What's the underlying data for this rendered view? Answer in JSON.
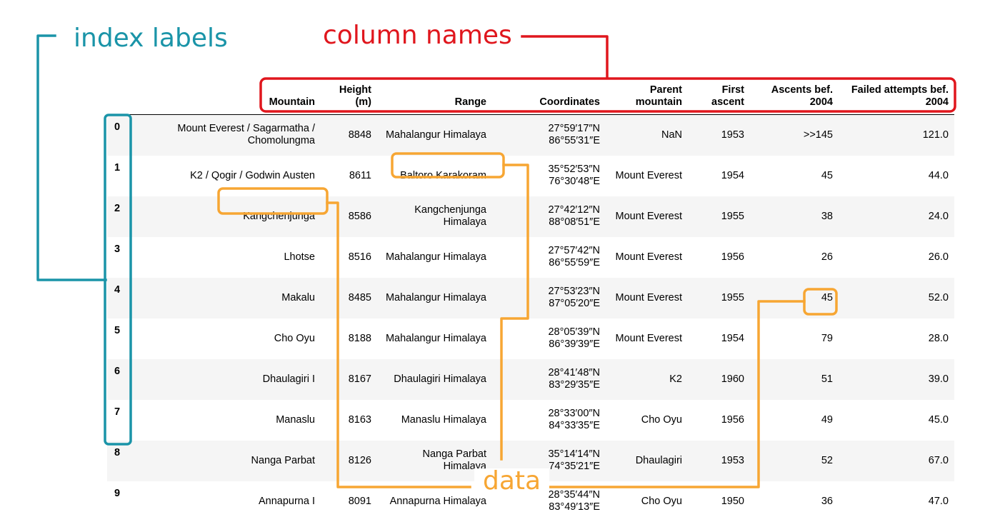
{
  "annotations": {
    "index_labels": "index labels",
    "column_names": "column names",
    "data": "data"
  },
  "colors": {
    "index": "#1a94a8",
    "columns": "#e0161d",
    "data": "#f7a633"
  },
  "table": {
    "columns": [
      {
        "key": "mountain",
        "label": "Mountain"
      },
      {
        "key": "height",
        "label": "Height (m)"
      },
      {
        "key": "range",
        "label": "Range"
      },
      {
        "key": "coordinates",
        "label": "Coordinates"
      },
      {
        "key": "parent",
        "label": "Parent mountain"
      },
      {
        "key": "first_ascent",
        "label": "First ascent"
      },
      {
        "key": "ascents",
        "label": "Ascents bef. 2004"
      },
      {
        "key": "failed",
        "label": "Failed attempts bef. 2004"
      }
    ],
    "rows": [
      {
        "index": "0",
        "mountain": "Mount Everest / Sagarmatha / Chomolungma",
        "height": "8848",
        "range": "Mahalangur Himalaya",
        "coordinates": "27°59′17″N 86°55′31″E",
        "parent": "NaN",
        "first_ascent": "1953",
        "ascents": ">>145",
        "failed": "121.0"
      },
      {
        "index": "1",
        "mountain": "K2 / Qogir / Godwin Austen",
        "height": "8611",
        "range": "Baltoro Karakoram",
        "coordinates": "35°52′53″N 76°30′48″E",
        "parent": "Mount Everest",
        "first_ascent": "1954",
        "ascents": "45",
        "failed": "44.0"
      },
      {
        "index": "2",
        "mountain": "Kangchenjunga",
        "height": "8586",
        "range": "Kangchenjunga Himalaya",
        "coordinates": "27°42′12″N 88°08′51″E",
        "parent": "Mount Everest",
        "first_ascent": "1955",
        "ascents": "38",
        "failed": "24.0"
      },
      {
        "index": "3",
        "mountain": "Lhotse",
        "height": "8516",
        "range": "Mahalangur Himalaya",
        "coordinates": "27°57′42″N 86°55′59″E",
        "parent": "Mount Everest",
        "first_ascent": "1956",
        "ascents": "26",
        "failed": "26.0"
      },
      {
        "index": "4",
        "mountain": "Makalu",
        "height": "8485",
        "range": "Mahalangur Himalaya",
        "coordinates": "27°53′23″N 87°05′20″E",
        "parent": "Mount Everest",
        "first_ascent": "1955",
        "ascents": "45",
        "failed": "52.0"
      },
      {
        "index": "5",
        "mountain": "Cho Oyu",
        "height": "8188",
        "range": "Mahalangur Himalaya",
        "coordinates": "28°05′39″N 86°39′39″E",
        "parent": "Mount Everest",
        "first_ascent": "1954",
        "ascents": "79",
        "failed": "28.0"
      },
      {
        "index": "6",
        "mountain": "Dhaulagiri I",
        "height": "8167",
        "range": "Dhaulagiri Himalaya",
        "coordinates": "28°41′48″N 83°29′35″E",
        "parent": "K2",
        "first_ascent": "1960",
        "ascents": "51",
        "failed": "39.0"
      },
      {
        "index": "7",
        "mountain": "Manaslu",
        "height": "8163",
        "range": "Manaslu Himalaya",
        "coordinates": "28°33′00″N 84°33′35″E",
        "parent": "Cho Oyu",
        "first_ascent": "1956",
        "ascents": "49",
        "failed": "45.0"
      },
      {
        "index": "8",
        "mountain": "Nanga Parbat",
        "height": "8126",
        "range": "Nanga Parbat Himalaya",
        "coordinates": "35°14′14″N 74°35′21″E",
        "parent": "Dhaulagiri",
        "first_ascent": "1953",
        "ascents": "52",
        "failed": "67.0"
      },
      {
        "index": "9",
        "mountain": "Annapurna I",
        "height": "8091",
        "range": "Annapurna Himalaya",
        "coordinates": "28°35′44″N 83°49′13″E",
        "parent": "Cho Oyu",
        "first_ascent": "1950",
        "ascents": "36",
        "failed": "47.0"
      }
    ]
  }
}
